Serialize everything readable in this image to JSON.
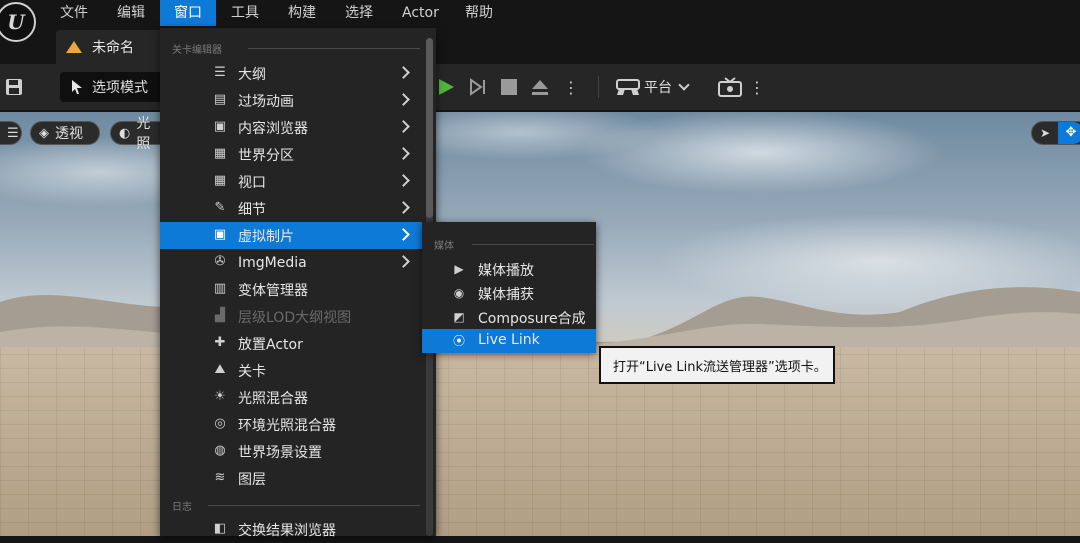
{
  "menubar": {
    "items": [
      {
        "label": "文件"
      },
      {
        "label": "编辑"
      },
      {
        "label": "窗口"
      },
      {
        "label": "工具"
      },
      {
        "label": "构建"
      },
      {
        "label": "选择"
      },
      {
        "label": "Actor"
      },
      {
        "label": "帮助"
      }
    ],
    "active_index": 2
  },
  "tab": {
    "title": "未命名"
  },
  "toolbar": {
    "mode_label": "选项模式",
    "platform_label": "平台"
  },
  "viewport_bar": {
    "perspective_label": "透视",
    "lit_label": "光照"
  },
  "window_menu": {
    "section_level_editor": "关卡编辑器",
    "items": [
      {
        "label": "大纲",
        "icon": "outliner-icon",
        "submenu": true
      },
      {
        "label": "过场动画",
        "icon": "cinematics-icon",
        "submenu": true
      },
      {
        "label": "内容浏览器",
        "icon": "content-browser-icon",
        "submenu": true
      },
      {
        "label": "世界分区",
        "icon": "world-partition-icon",
        "submenu": true
      },
      {
        "label": "视口",
        "icon": "viewport-icon",
        "submenu": true
      },
      {
        "label": "细节",
        "icon": "details-icon",
        "submenu": true
      },
      {
        "label": "虚拟制片",
        "icon": "virtual-production-icon",
        "submenu": true,
        "highlighted": true
      },
      {
        "label": "ImgMedia",
        "icon": "film-reel-icon",
        "submenu": true
      },
      {
        "label": "变体管理器",
        "icon": "variant-manager-icon",
        "submenu": false
      },
      {
        "label": "层级LOD大纲视图",
        "icon": "hlod-icon",
        "submenu": false,
        "disabled": true
      },
      {
        "label": "放置Actor",
        "icon": "place-actor-icon",
        "submenu": false
      },
      {
        "label": "关卡",
        "icon": "levels-icon",
        "submenu": false
      },
      {
        "label": "光照混合器",
        "icon": "light-mixer-icon",
        "submenu": false
      },
      {
        "label": "环境光照混合器",
        "icon": "env-light-mixer-icon",
        "submenu": false
      },
      {
        "label": "世界场景设置",
        "icon": "world-settings-icon",
        "submenu": false
      },
      {
        "label": "图层",
        "icon": "layers-icon",
        "submenu": false
      }
    ],
    "section_log": "日志",
    "log_items": [
      {
        "label": "交换结果浏览器",
        "icon": "interchange-icon"
      }
    ]
  },
  "virtual_production_submenu": {
    "section_media": "媒体",
    "items": [
      {
        "label": "媒体播放",
        "icon": "media-player-icon"
      },
      {
        "label": "媒体捕获",
        "icon": "media-capture-icon"
      },
      {
        "label": "Composure合成",
        "icon": "composure-icon"
      },
      {
        "label": "Live Link",
        "icon": "live-link-icon",
        "highlighted": true
      }
    ]
  },
  "tooltip": {
    "text": "打开“Live Link流送管理器”选项卡。"
  }
}
